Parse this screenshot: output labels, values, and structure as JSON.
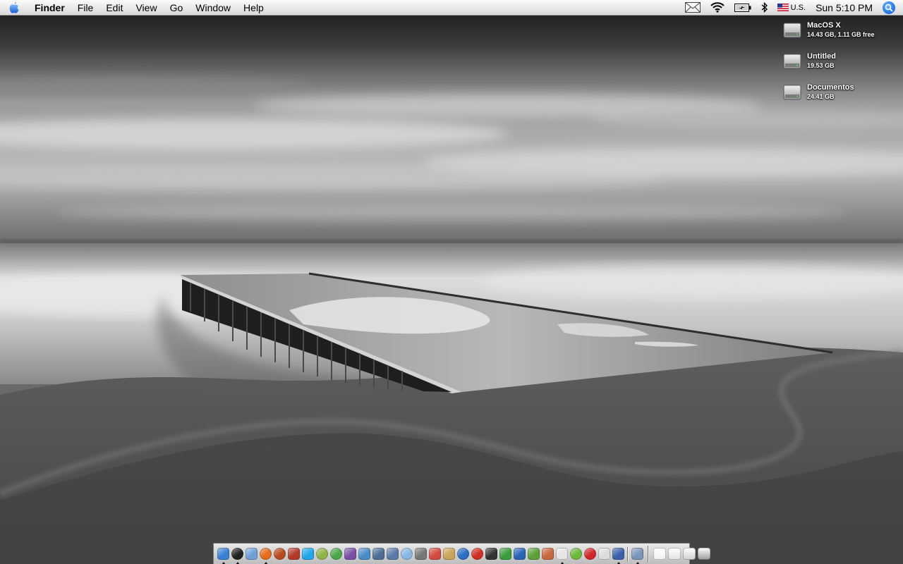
{
  "menubar": {
    "apple_icon": "apple-icon",
    "app_name": "Finder",
    "menus": [
      "File",
      "Edit",
      "View",
      "Go",
      "Window",
      "Help"
    ],
    "status": {
      "mail_icon": "envelope-icon",
      "wifi_icon": "wifi-icon",
      "battery_icon": "battery-charging-icon",
      "bluetooth_icon": "bluetooth-icon",
      "input_flag_icon": "us-flag-icon",
      "input_source": "U.S.",
      "clock": "Sun 5:10 PM",
      "spotlight_icon": "spotlight-icon",
      "spotlight_color": "#2a7fe8"
    }
  },
  "desktop": {
    "volumes": [
      {
        "name": "MacOS X",
        "info": "14.43 GB, 1.11 GB free",
        "icon": "hard-drive-icon"
      },
      {
        "name": "Untitled",
        "info": "19.53 GB",
        "icon": "hard-drive-icon"
      },
      {
        "name": "Documentos",
        "info": "24.41 GB",
        "icon": "hard-drive-icon"
      }
    ]
  },
  "dock": {
    "apps": [
      {
        "name": "finder-icon",
        "color": "#3a7fd5",
        "running": true
      },
      {
        "name": "dashboard-icon",
        "color": "#222222",
        "running": true
      },
      {
        "name": "preview-icon",
        "color": "#6f9fd6",
        "running": false
      },
      {
        "name": "firefox-icon",
        "color": "#e46c1e",
        "running": true
      },
      {
        "name": "itunes-app-icon",
        "color": "#b74a1d",
        "running": false
      },
      {
        "name": "figure-icon",
        "color": "#b33a2a",
        "running": false
      },
      {
        "name": "skype-icon",
        "color": "#22a7e8",
        "running": false
      },
      {
        "name": "colorsync-icon",
        "color": "#8fb34a",
        "running": false
      },
      {
        "name": "itunes-icon",
        "color": "#4ba64a",
        "running": false
      },
      {
        "name": "photoshop-icon",
        "color": "#7a4fa3",
        "running": false
      },
      {
        "name": "mail-icon",
        "color": "#4a8cc8",
        "running": false
      },
      {
        "name": "network-icon",
        "color": "#4d6e94",
        "running": false
      },
      {
        "name": "system-tool-icon",
        "color": "#5a79a8",
        "running": false
      },
      {
        "name": "safari-icon",
        "color": "#89b8e3",
        "running": false
      },
      {
        "name": "x11-icon",
        "color": "#777777",
        "running": false
      },
      {
        "name": "ical-icon",
        "color": "#d24a3d",
        "running": false
      },
      {
        "name": "notes-icon",
        "color": "#c9a45a",
        "running": false
      },
      {
        "name": "quicktime-icon",
        "color": "#2b6dc4",
        "running": false
      },
      {
        "name": "tomato-icon",
        "color": "#cf2f22",
        "running": false
      },
      {
        "name": "stickies-icon",
        "color": "#333333",
        "running": false
      },
      {
        "name": "frog-icon",
        "color": "#3a9c3a",
        "running": false
      },
      {
        "name": "word-icon",
        "color": "#2a62b8",
        "running": false
      },
      {
        "name": "gecko-icon",
        "color": "#5ba03a",
        "running": false
      },
      {
        "name": "textedit-icon",
        "color": "#c7673e",
        "running": false
      },
      {
        "name": "script-icon",
        "color": "#e6e6e6",
        "running": true
      },
      {
        "name": "dreamweaver-icon",
        "color": "#6fb93a",
        "running": false
      },
      {
        "name": "flash-icon",
        "color": "#d1272a",
        "running": false
      },
      {
        "name": "utility-icon",
        "color": "#dcdcdc",
        "running": false
      },
      {
        "name": "info-icon",
        "color": "#3b5fa8",
        "running": true
      },
      {
        "name": "preferences-icon",
        "color": "#7b95b9",
        "running": true
      }
    ],
    "docs": [
      {
        "name": "doc-window-icon",
        "color": "#f0f0f0"
      },
      {
        "name": "doc-window2-icon",
        "color": "#e3e3e3"
      },
      {
        "name": "doc-window3-icon",
        "color": "#d0d0d0"
      },
      {
        "name": "trash-icon",
        "color": "#9a9a9a"
      }
    ]
  }
}
